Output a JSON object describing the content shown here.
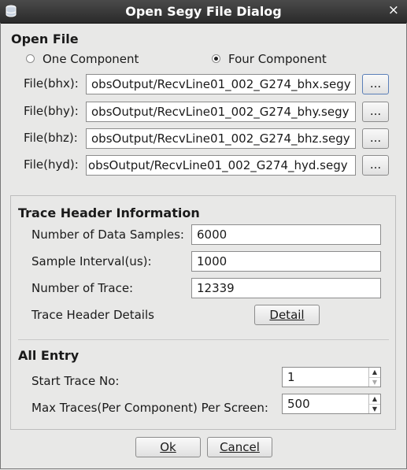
{
  "window": {
    "title": "Open Segy File Dialog",
    "close_glyph": "×"
  },
  "open_file": {
    "heading": "Open File",
    "radio_one": "One Component",
    "radio_four": "Four Component",
    "selected": "four",
    "rows": [
      {
        "label": "File(bhx):",
        "value": "obsOutput/RecvLine01_002_G274_bhx.segy",
        "browse": "..."
      },
      {
        "label": "File(bhy):",
        "value": "obsOutput/RecvLine01_002_G274_bhy.segy",
        "browse": "..."
      },
      {
        "label": "File(bhz):",
        "value": "obsOutput/RecvLine01_002_G274_bhz.segy",
        "browse": "..."
      },
      {
        "label": "File(hyd):",
        "value": "obsOutput/RecvLine01_002_G274_hyd.segy",
        "browse": "..."
      }
    ]
  },
  "trace_header": {
    "heading": "Trace Header Information",
    "samples_label": "Number of Data Samples:",
    "samples_value": "6000",
    "interval_label": "Sample Interval(us):",
    "interval_value": "1000",
    "traces_label": "Number of Trace:",
    "traces_value": "12339",
    "details_label": "Trace Header Details",
    "detail_button": "Detail"
  },
  "all_entry": {
    "heading": "All Entry",
    "start_label": "Start Trace No:",
    "start_value": "1",
    "max_label": "Max Traces(Per Component) Per Screen:",
    "max_value": "500"
  },
  "buttons": {
    "ok": "Ok",
    "cancel": "Cancel"
  }
}
